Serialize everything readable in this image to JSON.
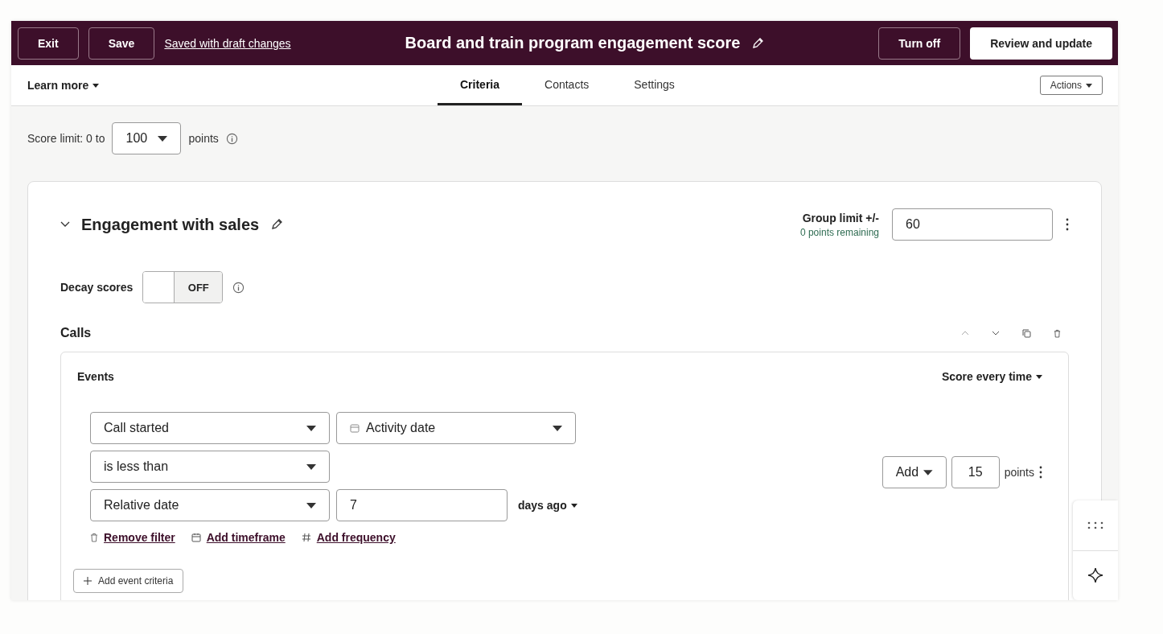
{
  "header": {
    "exit": "Exit",
    "save": "Save",
    "saved_status": "Saved with draft changes",
    "title": "Board and train program engagement score",
    "turn_off": "Turn off",
    "review": "Review and update"
  },
  "nav": {
    "learn_more": "Learn more",
    "tabs": [
      {
        "label": "Criteria",
        "selected": true
      },
      {
        "label": "Contacts",
        "selected": false
      },
      {
        "label": "Settings",
        "selected": false
      }
    ],
    "actions": "Actions"
  },
  "score_limit": {
    "label": "Score limit: 0 to",
    "value": "100",
    "unit": "points"
  },
  "group": {
    "title": "Engagement with sales",
    "expanded": true,
    "limit_label": "Group limit +/-",
    "remaining": "0 points remaining",
    "limit_value": "60",
    "decay": {
      "label": "Decay scores",
      "on": false,
      "state_label": "OFF"
    },
    "section": "Calls",
    "events": {
      "title": "Events",
      "scoring": "Score every time",
      "rows": [
        [
          {
            "kind": "select",
            "value": "Call started"
          },
          {
            "kind": "date_select",
            "value": "Activity date"
          }
        ],
        [
          {
            "kind": "select",
            "value": "is less than"
          }
        ],
        [
          {
            "kind": "select",
            "value": "Relative date"
          },
          {
            "kind": "input",
            "value": "7"
          },
          {
            "kind": "dropdown",
            "value": "days ago"
          }
        ]
      ],
      "links": [
        {
          "kind": "remove",
          "label": "Remove filter"
        },
        {
          "kind": "timeframe",
          "label": "Add timeframe"
        },
        {
          "kind": "frequency",
          "label": "Add frequency"
        }
      ],
      "operation": "Add",
      "points": "15",
      "points_unit": "points",
      "add_criteria": "Add event criteria"
    }
  }
}
